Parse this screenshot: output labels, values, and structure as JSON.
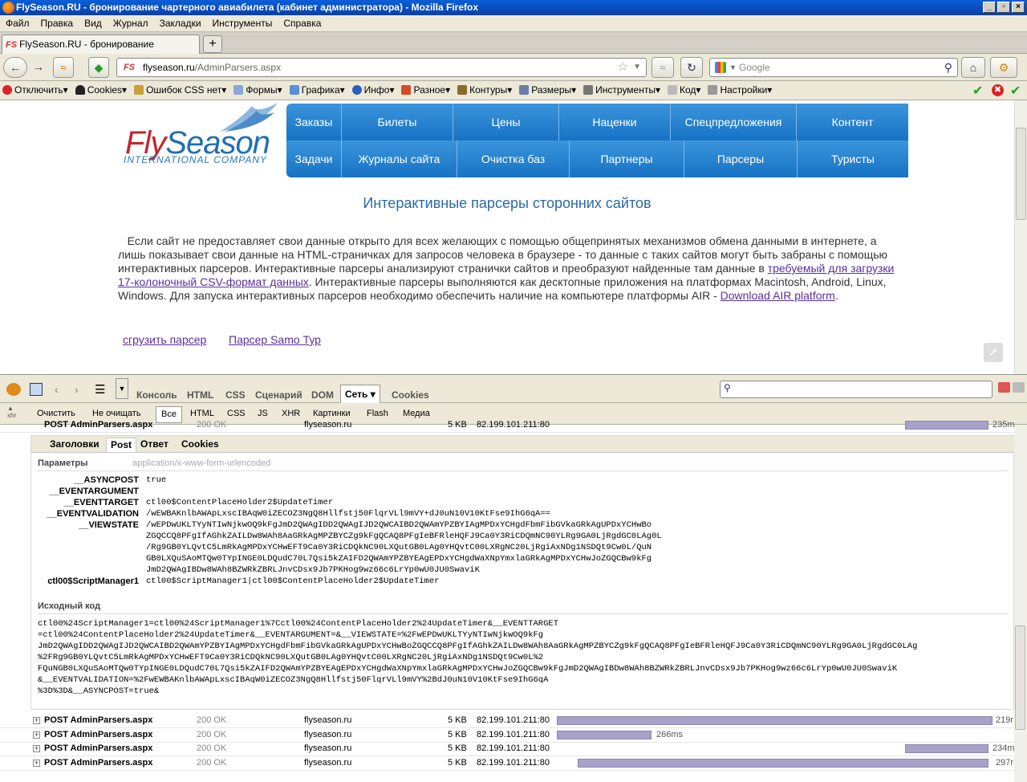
{
  "window": {
    "title": "FlySeason.RU - бронирование чартерного авиабилета (кабинет администратора) - Mozilla Firefox"
  },
  "menubar": [
    "Файл",
    "Правка",
    "Вид",
    "Журнал",
    "Закладки",
    "Инструменты",
    "Справка"
  ],
  "tab": {
    "label": "FlySeason.RU - бронирование чартерного ...",
    "icon": "FS"
  },
  "url": {
    "host": "flyseason.ru",
    "path": "/AdminParsers.aspx"
  },
  "search": {
    "placeholder": "Google"
  },
  "bookmarks": [
    "Отключить▾",
    "Cookies▾",
    "Ошибок CSS нет▾",
    "Формы▾",
    "Графика▾",
    "Инфо▾",
    "Разное▾",
    "Контуры▾",
    "Размеры▾",
    "Инструменты▾",
    "Код▾",
    "Настройки▾"
  ],
  "site": {
    "logo_fly": "Fly",
    "logo_season": "Season",
    "logo_sub": "INTERNATIONAL COMPANY",
    "menu_row1": [
      "Заказы",
      "Билеты",
      "Цены",
      "Наценки",
      "Спецпредложения",
      "Контент"
    ],
    "menu_row2": [
      "Задачи",
      "Журналы сайта",
      "Очистка баз",
      "Партнеры",
      "Парсеры",
      "Туристы"
    ],
    "heading": "Интерактивные парсеры сторонних сайтов",
    "para_1": "Если сайт не предоставляет свои данные открыто для всех желающих с помощью общепринятых механизмов обмена данными в интернете, а лишь показывает свои данные на HTML-страничках для запросов человека в браузере - то данные с таких сайтов могут быть забраны с помощью интерактивных парсеров. Интерактивные парсеры анализируют странички сайтов и преобразуют найденные там данные в ",
    "link_csv": "требуемый для загрузки 17-колоночный CSV-формат данных",
    "para_2": ". Интерактивные парсеры выполняются как десктопные приложения на платформах Macintosh, Android, Linux, Windows. Для запуска интерактивных парсеров необходимо обеспечить наличие на компьютере платформы AIR - ",
    "link_air": "Download AIR platform",
    "para_3": ".",
    "link_parser": "сгрузить парсер",
    "link_samo": "Парсер Samo Тур"
  },
  "firebug": {
    "tabs": [
      "Консоль",
      "HTML",
      "CSS",
      "Сценарий",
      "DOM",
      "Сеть ▾",
      "Cookies"
    ],
    "net_buttons": [
      "Очистить",
      "Не очищать",
      "Все",
      "HTML",
      "CSS",
      "JS",
      "XHR",
      "Картинки",
      "Flash",
      "Медиа"
    ],
    "detail_tabs": [
      "Заголовки",
      "Post",
      "Ответ",
      "Cookies"
    ],
    "params_title": "Параметры",
    "params_type": "application/x-www-form-urlencoded",
    "params": [
      {
        "key": "__ASYNCPOST",
        "lines": [
          "true"
        ]
      },
      {
        "key": "__EVENTARGUMENT",
        "lines": [
          ""
        ]
      },
      {
        "key": "__EVENTTARGET",
        "lines": [
          "ctl00$ContentPlaceHolder2$UpdateTimer"
        ]
      },
      {
        "key": "__EVENTVALIDATION",
        "lines": [
          "/wEWBAKnlbAWApLxscIBAqW0iZECOZ3NgQ8Hllfstj50FlqrVLl9mVY+dJ0uN10V10KtFse9IhG6qA=="
        ]
      },
      {
        "key": "__VIEWSTATE",
        "lines": [
          "/wEPDwUKLTYyNTIwNjkwOQ9kFgJmD2QWAgIDD2QWAgIJD2QWCAIBD2QWAmYPZBYIAgMPDxYCHgdFbmFibGVkaGRkAgUPDxYCHwBo",
          "ZGQCCQ8PFgIfAGhkZAILDw8WAh8AaGRkAgMPZBYCZg9kFgQCAQ8PFgIeBFRleHQFJ9Ca0Y3RiCDQmNC90YLRg9GA0LjRgdGC0LAg0L",
          "/Rg9GB0YLQvtC5LmRkAgMPDxYCHwEFT9Ca0Y3RiCDQkNC90LXQutGB0LAg0YHQvtC00LXRgNC20LjRgiAxNDg1NSDQt9Cw0L/QuN",
          "GB0LXQuSAoMTQw0TYpINGE0LDQudC70L7Qsi5kZAIFD2QWAmYPZBYEAgEPDxYCHgdWaXNpYmxlaGRkAgMPDxYCHwJoZGQCBw9kFg",
          "JmD2QWAgIBDw8WAh8BZWRkZBRLJnvCDsx9Jb7PKHog9wz66c6LrYp0wU0JU0SwaviK"
        ]
      },
      {
        "key": "ctl00$ScriptManager1",
        "lines": [
          "ctl00$ScriptManager1|ctl00$ContentPlaceHolder2$UpdateTimer"
        ]
      }
    ],
    "source_title": "Исходный код",
    "source_lines": [
      "ctl00%24ScriptManager1=ctl00%24ScriptManager1%7Cctl00%24ContentPlaceHolder2%24UpdateTimer&__EVENTTARGET",
      "=ctl00%24ContentPlaceHolder2%24UpdateTimer&__EVENTARGUMENT=&__VIEWSTATE=%2FwEPDwUKLTYyNTIwNjkwOQ9kFg",
      "JmD2QWAgIDD2QWAgIJD2QWCAIBD2QWAmYPZBYIAgMPDxYCHgdFbmFibGVkaGRkAgUPDxYCHwBoZGQCCQ8PFgIfAGhkZAILDw8WAh8AaGRkAgMPZBYCZg9kFgQCAQ8PFgIeBFRleHQFJ9Ca0Y3RiCDQmNC90YLRg9GA0LjRgdGC0LAg",
      "%2FRg9GB0YLQvtC5LmRkAgMPDxYCHwEFT9Ca0Y3RiCDQkNC90LXQutGB0LAg0YHQvtC00LXRgNC20LjRgiAxNDg1NSDQt9Cw0L%2",
      "FQuNGB0LXQuSAoMTQw0TYpINGE0LDQudC70L7Qsi5kZAIFD2QWAmYPZBYEAgEPDxYCHgdWaXNpYmxlaGRkAgMPDxYCHwJoZGQCBw9kFgJmD2QWAgIBDw8WAh8BZWRkZBRLJnvCDsx9Jb7PKHog9wz66c6LrYp0wU0JU0SwaviK",
      "&__EVENTVALIDATION=%2FwEWBAKnlbAWApLxscIBAqW0iZECOZ3NgQ8Hllfstj50FlqrVLl9mVY%2BdJ0uN10V10KtFse9IhG6qA",
      "%3D%3D&__ASYNCPOST=true&"
    ],
    "rows": [
      {
        "method": "POST AdminParsers.aspx",
        "status": "200 OK",
        "domain": "flyseason.ru",
        "size": "5 KB",
        "ip": "82.199.101.211:80",
        "time": "235m"
      },
      {
        "method": "POST AdminParsers.aspx",
        "status": "200 OK",
        "domain": "flyseason.ru",
        "size": "5 KB",
        "ip": "82.199.101.211:80",
        "time": "219r"
      },
      {
        "method": "POST AdminParsers.aspx",
        "status": "200 OK",
        "domain": "flyseason.ru",
        "size": "5 KB",
        "ip": "82.199.101.211:80",
        "time": "266ms"
      },
      {
        "method": "POST AdminParsers.aspx",
        "status": "200 OK",
        "domain": "flyseason.ru",
        "size": "5 KB",
        "ip": "82.199.101.211:80",
        "time": "234m"
      },
      {
        "method": "POST AdminParsers.aspx",
        "status": "200 OK",
        "domain": "flyseason.ru",
        "size": "5 KB",
        "ip": "82.199.101.211:80",
        "time": "297r"
      }
    ]
  },
  "colors": {
    "site_menu": "#1f7fd0",
    "heading": "#2a69a8",
    "link": "#5a2f9e",
    "netbar": "#a9a2c8"
  }
}
